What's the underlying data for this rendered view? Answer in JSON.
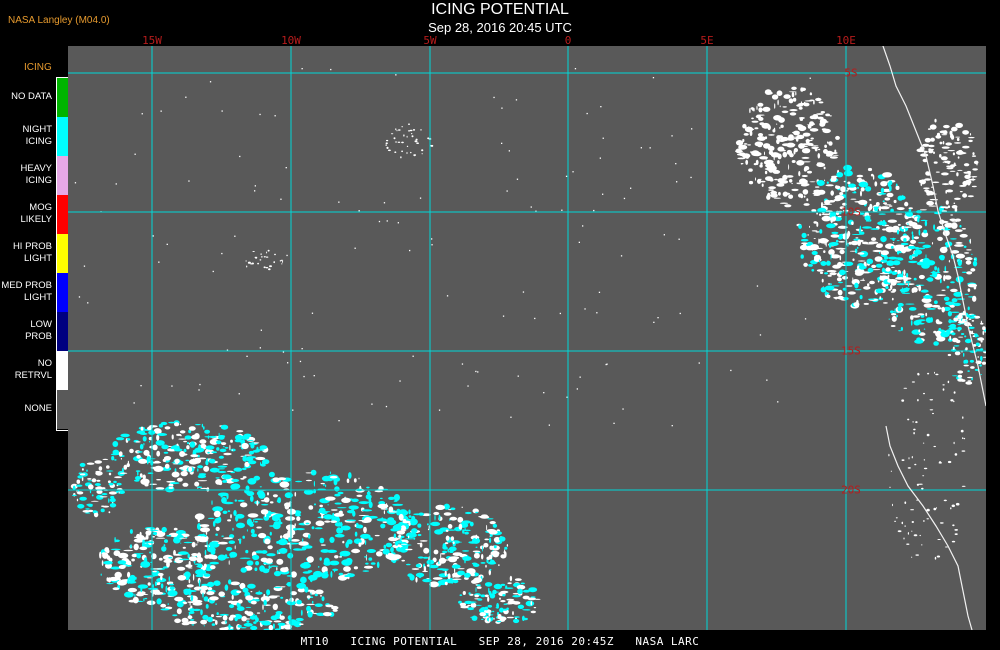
{
  "header": {
    "title": "ICING POTENTIAL",
    "subtitle": "Sep 28, 2016 20:45 UTC",
    "source": "NASA Langley (M04.0)"
  },
  "legend": {
    "heading": "ICING",
    "items": [
      {
        "label": "NO DATA",
        "color": "#00b400"
      },
      {
        "label": "NIGHT ICING",
        "color": "#00ffff"
      },
      {
        "label": "HEAVY ICING",
        "color": "#e6a8e6"
      },
      {
        "label": "MOG LIKELY",
        "color": "#ff0000"
      },
      {
        "label": "HI PROB LIGHT",
        "color": "#ffff00"
      },
      {
        "label": "MED PROB LIGHT",
        "color": "#0000ff"
      },
      {
        "label": "LOW PROB",
        "color": "#000080"
      },
      {
        "label": "NO RETRVL",
        "color": "#ffffff"
      },
      {
        "label": "NONE",
        "color": "#595959"
      }
    ]
  },
  "map": {
    "background_color": "#595959",
    "grid_color": "#00d8d8",
    "label_color": "#b71c1c",
    "longitude_labels": [
      "15W",
      "10W",
      "5W",
      "0",
      "5E",
      "10E"
    ],
    "latitude_labels": [
      "5S",
      "10S",
      "15S",
      "20S"
    ],
    "coastline": "southwest Africa coastline"
  },
  "footer": {
    "text": "MT10   ICING POTENTIAL   SEP 28, 2016 20:45Z   NASA LARC"
  }
}
